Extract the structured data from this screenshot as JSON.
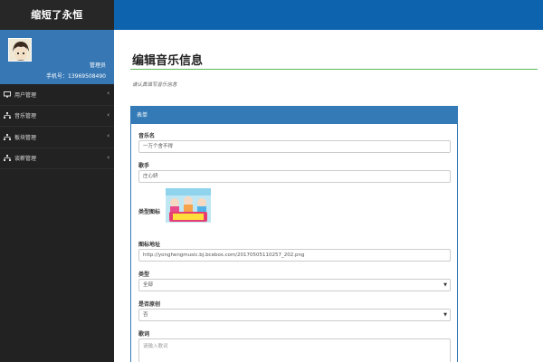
{
  "sidebar": {
    "brand": "缩短了永恒",
    "profile": {
      "role": "管理员",
      "phone": "手机号：13969508490"
    },
    "items": [
      {
        "label": "用户管理",
        "icon": "monitor-icon"
      },
      {
        "label": "音乐管理",
        "icon": "sitemap-icon"
      },
      {
        "label": "板块管理",
        "icon": "sitemap-icon"
      },
      {
        "label": "谈薪管理",
        "icon": "sitemap-icon"
      }
    ]
  },
  "main": {
    "title": "编辑音乐信息",
    "subtitle": "请认真填写音乐信息",
    "panel_title": "表单",
    "fields": {
      "name_label": "音乐名",
      "name_value": "一万个舍不得",
      "singer_label": "歌手",
      "singer_value": "庄心妍",
      "cover_label": "类型图标",
      "url_label": "图标地址",
      "url_value": "http://yonghengmusic.bj.bcebos.com/20170505110257_202.png",
      "type_label": "类型",
      "type_value": "全部",
      "original_label": "是否原创",
      "original_value": "否",
      "lyrics_label": "歌词",
      "lyrics_placeholder": "请输入歌词"
    }
  },
  "colors": {
    "topbar": "#0d63ad",
    "profile": "#3677b4",
    "sidebar": "#222222",
    "accent_line": "#5cb85c",
    "panel": "#337ab7"
  }
}
